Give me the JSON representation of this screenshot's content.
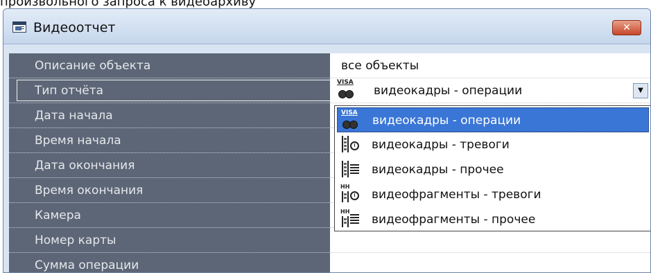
{
  "page_caption": "произвольного запроса к видеоархиву",
  "window": {
    "title": "Видеоотчет",
    "close_label": "✕"
  },
  "properties": [
    {
      "label": "Описание объекта",
      "value": "все объекты"
    },
    {
      "label": "Тип отчёта",
      "value": "видеокадры - операции",
      "icon": "visa-camera-icon"
    },
    {
      "label": "Дата начала",
      "value": ""
    },
    {
      "label": "Время начала",
      "value": ""
    },
    {
      "label": "Дата окончания",
      "value": ""
    },
    {
      "label": "Время окончания",
      "value": ""
    },
    {
      "label": "Камера",
      "value": ""
    },
    {
      "label": "Номер карты",
      "value": ""
    },
    {
      "label": "Сумма операции",
      "value": ""
    }
  ],
  "dropdown": {
    "arrow": "▼",
    "items": [
      {
        "label": "видеокадры - операции",
        "icon": "visa-camera-icon",
        "selected": true
      },
      {
        "label": "видеокадры - тревоги",
        "icon": "film-clock-icon",
        "selected": false
      },
      {
        "label": "видеокадры - прочее",
        "icon": "film-lines-icon",
        "selected": false
      },
      {
        "label": "видеофрагменты - тревоги",
        "icon": "fragment-clock-icon",
        "selected": false
      },
      {
        "label": "видеофрагменты - прочее",
        "icon": "fragment-lines-icon",
        "selected": false
      }
    ]
  },
  "icon_texts": {
    "visa": "VISA",
    "fragment": "HH"
  },
  "colors": {
    "label_panel": "#5c6676",
    "selection": "#3a76d6",
    "close_button": "#c6462a"
  }
}
